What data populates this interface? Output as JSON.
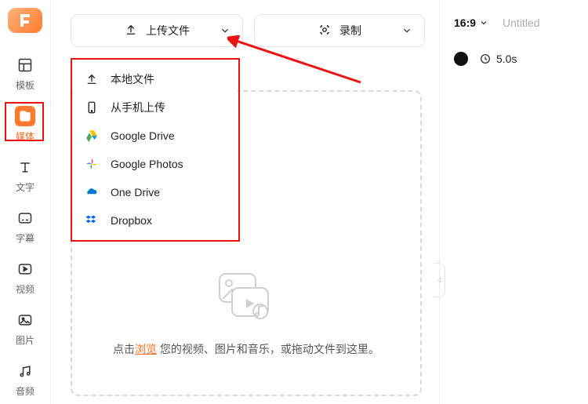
{
  "sidebar": {
    "items": [
      {
        "label": "模板"
      },
      {
        "label": "媒体"
      },
      {
        "label": "文字"
      },
      {
        "label": "字幕"
      },
      {
        "label": "视频"
      },
      {
        "label": "图片"
      },
      {
        "label": "音频"
      }
    ]
  },
  "toolbar": {
    "upload_label": "上传文件",
    "record_label": "录制"
  },
  "dropdown": {
    "items": [
      {
        "label": "本地文件"
      },
      {
        "label": "从手机上传"
      },
      {
        "label": "Google Drive"
      },
      {
        "label": "Google Photos"
      },
      {
        "label": "One Drive"
      },
      {
        "label": "Dropbox"
      }
    ]
  },
  "dropzone": {
    "prefix": "点击",
    "browse": "浏览",
    "suffix": " 您的视频、图片和音乐，或拖动文件到这里。"
  },
  "right": {
    "ratio": "16:9",
    "title": "Untitled",
    "duration": "5.0s"
  }
}
